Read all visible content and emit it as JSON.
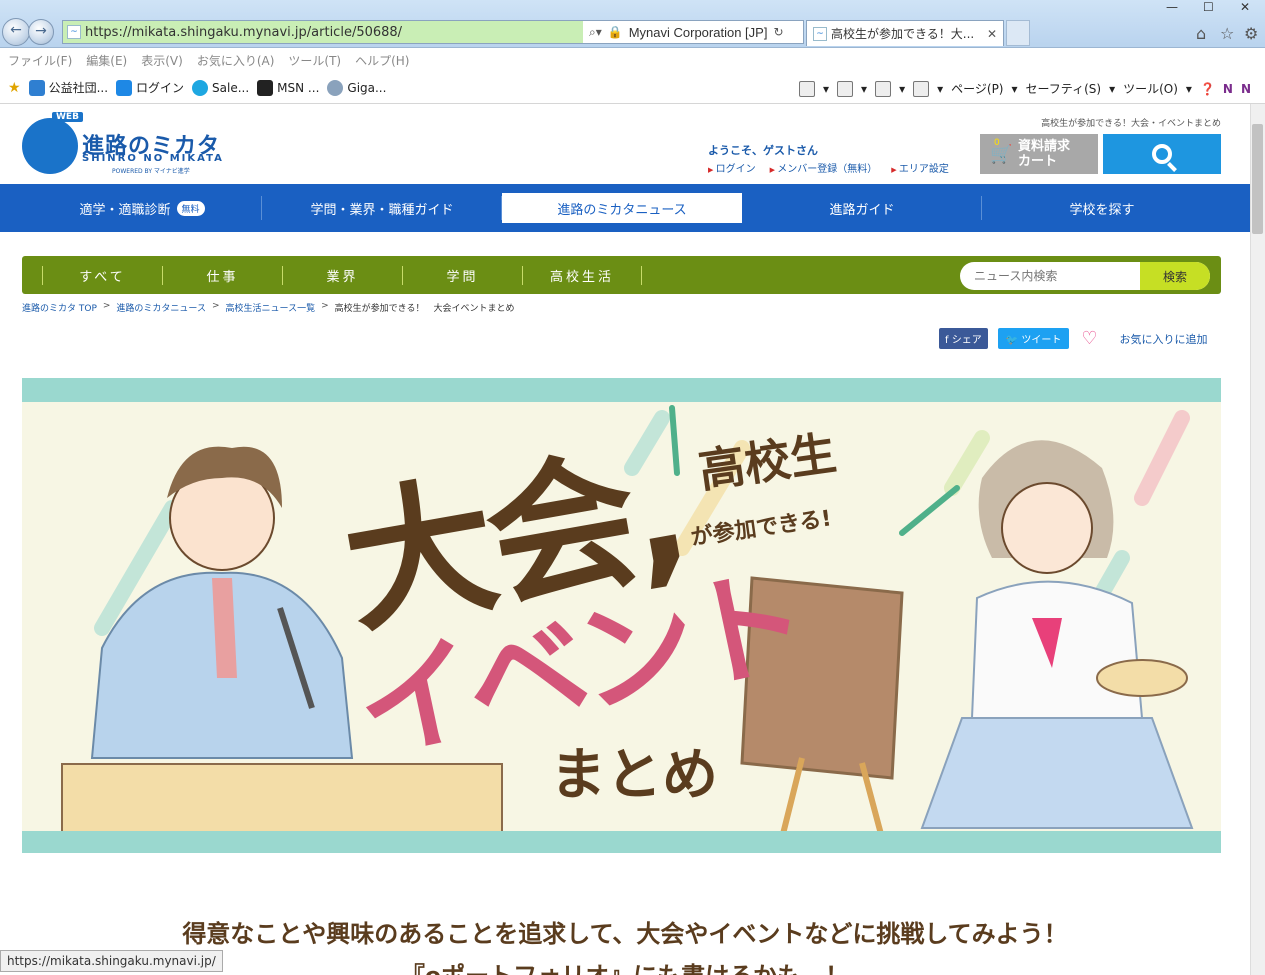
{
  "browser": {
    "url": "https://mikata.shingaku.mynavi.jp/article/50688/",
    "certificate": "Mynavi Corporation [JP]",
    "tab_title": "高校生が参加できる！大...",
    "menu": [
      "ファイル(F)",
      "編集(E)",
      "表示(V)",
      "お気に入り(A)",
      "ツール(T)",
      "ヘルプ(H)"
    ],
    "favorites": [
      {
        "label": "公益社団...",
        "color": "#2f7fd1"
      },
      {
        "label": "ログイン",
        "color": "#1e88e5"
      },
      {
        "label": "Sale...",
        "color": "#1ea7e1"
      },
      {
        "label": "MSN ...",
        "color": "#222222"
      },
      {
        "label": "Giga...",
        "color": "#8aa2bc"
      }
    ],
    "command_bar": [
      "ページ(P)",
      "セーフティ(S)",
      "ツール(O)"
    ],
    "status_url": "https://mikata.shingaku.mynavi.jp/"
  },
  "site": {
    "logo_web": "WEB",
    "logo_jp": "進路のミカタ",
    "logo_en": "SHINRO NO MIKATA",
    "logo_powered": "POWERED BY マイナビ進学",
    "page_heading_small": "高校生が参加できる！大会・イベントまとめ",
    "welcome": "ようこそ、ゲストさん",
    "user_links": [
      "ログイン",
      "メンバー登録（無料）",
      "エリア設定"
    ],
    "cart_count": "0",
    "cart_label": "資料請求\nカート",
    "main_nav": [
      {
        "label": "適学・適職診断",
        "badge": "無料"
      },
      {
        "label": "学問・業界・職種ガイド"
      },
      {
        "label": "進路のミカタニュース"
      },
      {
        "label": "進路ガイド"
      },
      {
        "label": "学校を探す"
      }
    ],
    "sub_nav": [
      "すべて",
      "仕事",
      "業界",
      "学問",
      "高校生活"
    ],
    "news_search_placeholder": "ニュース内検索",
    "news_search_button": "検索",
    "breadcrumb": [
      "進路のミカタ TOP",
      "進路のミカタニュース",
      "高校生活ニュース一覧",
      "高校生が参加できる！　大会イベントまとめ"
    ],
    "share": {
      "facebook": "シェア",
      "twitter": "ツイート",
      "favorite": "お気に入りに追加"
    },
    "hero": {
      "small_title": "高校生",
      "small_sub": "が参加できる!",
      "big_title_1": "大会,",
      "big_title_2": "イベント",
      "big_sub": "まとめ"
    },
    "lead_lines": [
      "得意なことや興味のあることを追求して、大会やイベントなどに挑戦してみよう！",
      "『eポートフォリオ』にも書けるかも…！"
    ]
  },
  "colors": {
    "brand_blue": "#1a60c2",
    "sub_nav_green": "#6b8e14",
    "search_button": "#1e96e0",
    "hero_stripe": "#9ad8cf",
    "hero_brown": "#5a3c1e",
    "hero_pink": "#d4567a",
    "hero_green": "#4fb08a"
  }
}
